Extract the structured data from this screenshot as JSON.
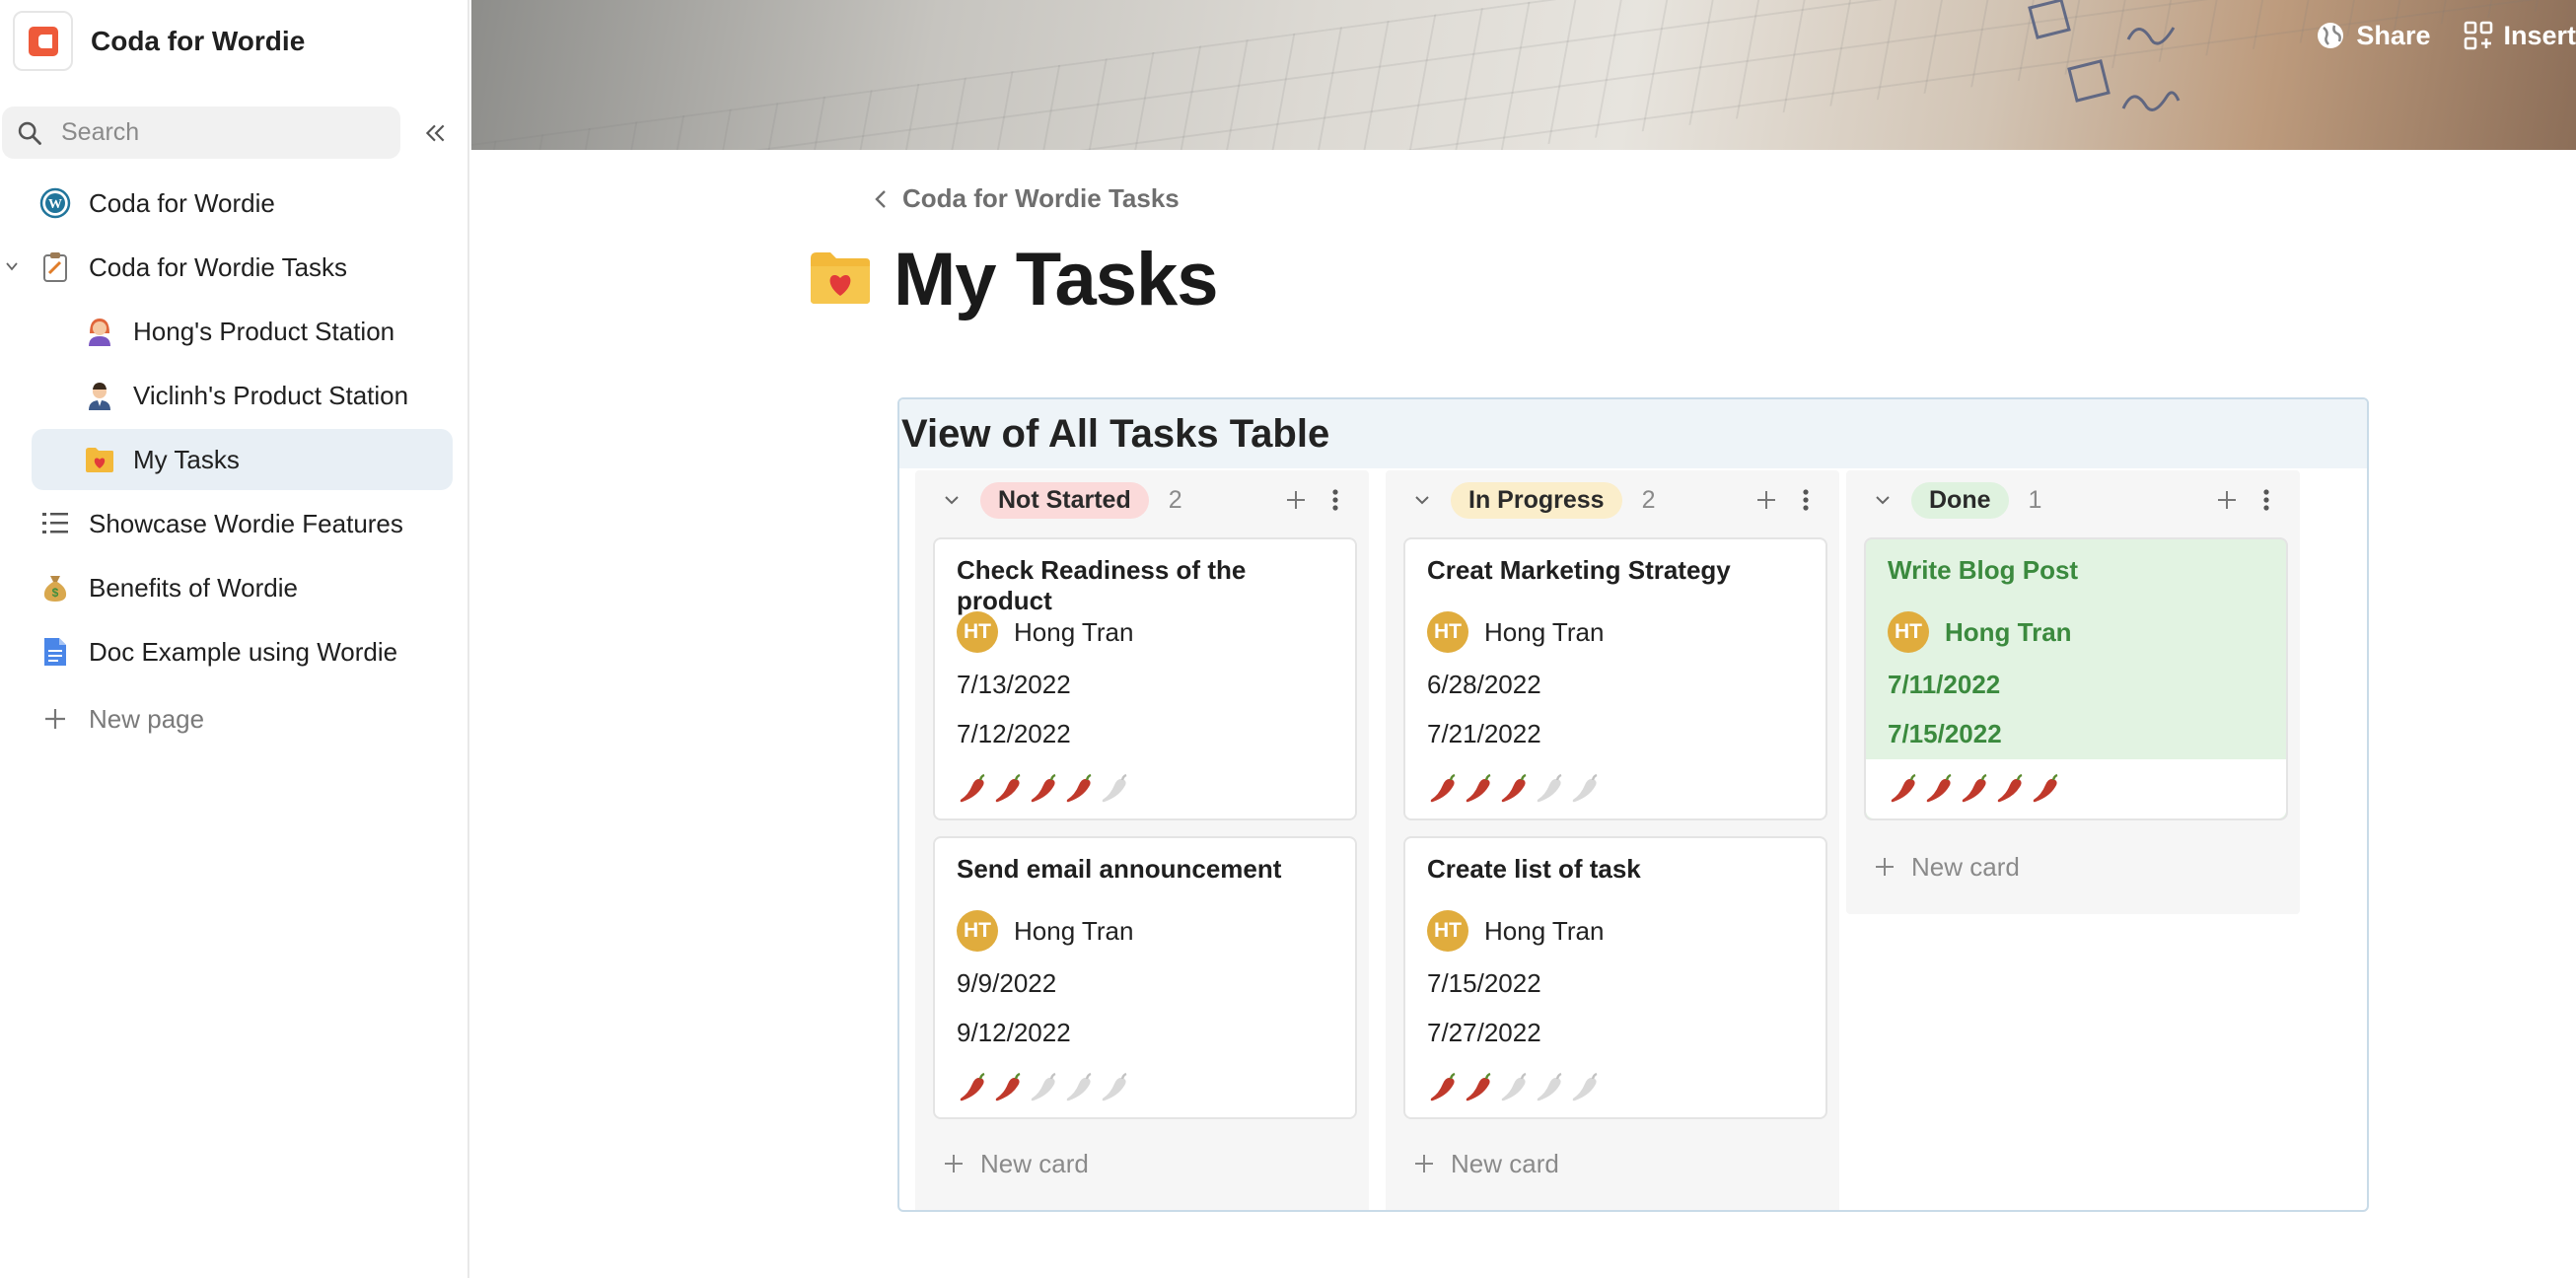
{
  "doc": {
    "title": "Coda for Wordie"
  },
  "search": {
    "placeholder": "Search"
  },
  "sidebar": {
    "items": [
      {
        "label": "Coda for Wordie",
        "icon": "wordpress-icon"
      },
      {
        "label": "Coda for Wordie Tasks",
        "icon": "clipboard-icon"
      },
      {
        "label": "Hong's Product Station",
        "icon": "woman-avatar-icon"
      },
      {
        "label": "Viclinh's Product Station",
        "icon": "man-avatar-icon"
      },
      {
        "label": "My Tasks",
        "icon": "folder-heart-icon"
      },
      {
        "label": "Showcase Wordie Features",
        "icon": "list-icon"
      },
      {
        "label": "Benefits of Wordie",
        "icon": "money-bag-icon"
      },
      {
        "label": "Doc Example using Wordie",
        "icon": "doc-icon"
      }
    ],
    "new_page": "New page"
  },
  "toolbar": {
    "share": "Share",
    "insert": "Insert"
  },
  "breadcrumb": {
    "label": "Coda for Wordie Tasks"
  },
  "page": {
    "title": "My Tasks"
  },
  "board": {
    "title": "View of All Tasks Table",
    "new_card_label": "New card",
    "columns": [
      {
        "status": "Not Started",
        "count": "2",
        "color": "#fbdada",
        "cards": [
          {
            "title": "Check Readiness of the product",
            "initials": "HT",
            "assignee": "Hong Tran",
            "start": "7/13/2022",
            "end": "7/12/2022",
            "rating": 4
          },
          {
            "title": "Send email announcement",
            "initials": "HT",
            "assignee": "Hong Tran",
            "start": "9/9/2022",
            "end": "9/12/2022",
            "rating": 2
          }
        ]
      },
      {
        "status": "In Progress",
        "count": "2",
        "color": "#fbeecb",
        "cards": [
          {
            "title": "Creat Marketing Strategy",
            "initials": "HT",
            "assignee": "Hong Tran",
            "start": "6/28/2022",
            "end": "7/21/2022",
            "rating": 3
          },
          {
            "title": "Create list of task",
            "initials": "HT",
            "assignee": "Hong Tran",
            "start": "7/15/2022",
            "end": "7/27/2022",
            "rating": 2
          }
        ]
      },
      {
        "status": "Done",
        "count": "1",
        "color": "#dff2df",
        "cards": [
          {
            "title": "Write Blog Post",
            "initials": "HT",
            "assignee": "Hong Tran",
            "start": "7/11/2022",
            "end": "7/15/2022",
            "rating": 5
          }
        ]
      }
    ],
    "rating_max": 5
  },
  "colors": {
    "accent": "#ee5a3a",
    "done_text": "#3b8a3e",
    "active_nav": "#e8eff5"
  }
}
